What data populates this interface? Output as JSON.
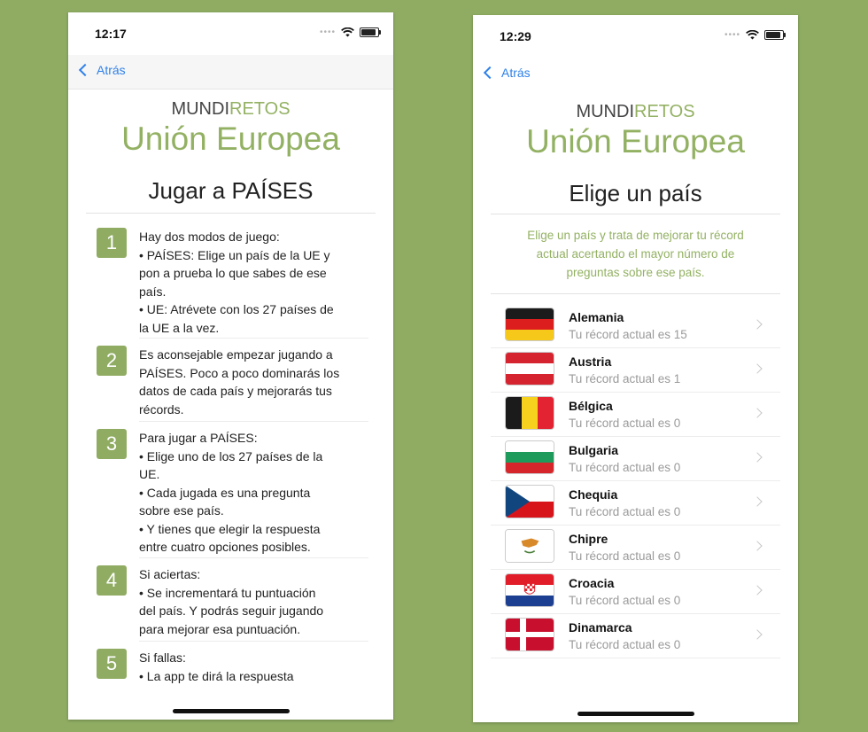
{
  "left": {
    "time": "12:17",
    "back": "Atrás",
    "brand_a": "MUNDI",
    "brand_b": "RETOS",
    "title": "Unión Europea",
    "heading": "Jugar a PAÍSES",
    "steps": [
      {
        "n": "1",
        "lines": [
          "Hay dos modos de juego:",
          "• PAÍSES: Elige un país de la UE y",
          "pon a prueba lo que sabes de ese",
          "país.",
          "• UE: Atrévete con los 27 países de",
          "la UE a la vez."
        ]
      },
      {
        "n": "2",
        "lines": [
          "Es aconsejable empezar jugando a",
          "PAÍSES. Poco a poco dominarás los",
          "datos de cada país y mejorarás tus",
          "récords."
        ]
      },
      {
        "n": "3",
        "lines": [
          "Para jugar a PAÍSES:",
          "• Elige uno de los 27 países de la",
          "UE.",
          "• Cada jugada es una pregunta",
          "sobre ese país.",
          "• Y tienes que elegir la respuesta",
          "entre cuatro opciones posibles."
        ]
      },
      {
        "n": "4",
        "lines": [
          "Si aciertas:",
          "• Se incrementará tu puntuación",
          "del país. Y podrás seguir jugando",
          "para mejorar esa puntuación."
        ]
      },
      {
        "n": "5",
        "lines": [
          "Si fallas:",
          "• La app te dirá la respuesta"
        ]
      }
    ]
  },
  "right": {
    "time": "12:29",
    "back": "Atrás",
    "brand_a": "MUNDI",
    "brand_b": "RETOS",
    "title": "Unión Europea",
    "heading": "Elige un país",
    "subtitle_lines": [
      "Elige un país y trata de mejorar tu récord",
      "actual acertando el mayor número de",
      "preguntas sobre ese país."
    ],
    "countries": [
      {
        "name": "Alemania",
        "record": "Tu récord actual es  15"
      },
      {
        "name": "Austria",
        "record": "Tu récord actual es  1"
      },
      {
        "name": "Bélgica",
        "record": "Tu récord actual es  0"
      },
      {
        "name": "Bulgaria",
        "record": "Tu récord actual es  0"
      },
      {
        "name": "Chequia",
        "record": "Tu récord actual es  0"
      },
      {
        "name": "Chipre",
        "record": "Tu récord actual es  0"
      },
      {
        "name": "Croacia",
        "record": "Tu récord actual es  0"
      },
      {
        "name": "Dinamarca",
        "record": "Tu récord actual es  0"
      }
    ]
  },
  "colors": {
    "accent": "#93b163",
    "background": "#8fac62",
    "link": "#2f80e9"
  }
}
